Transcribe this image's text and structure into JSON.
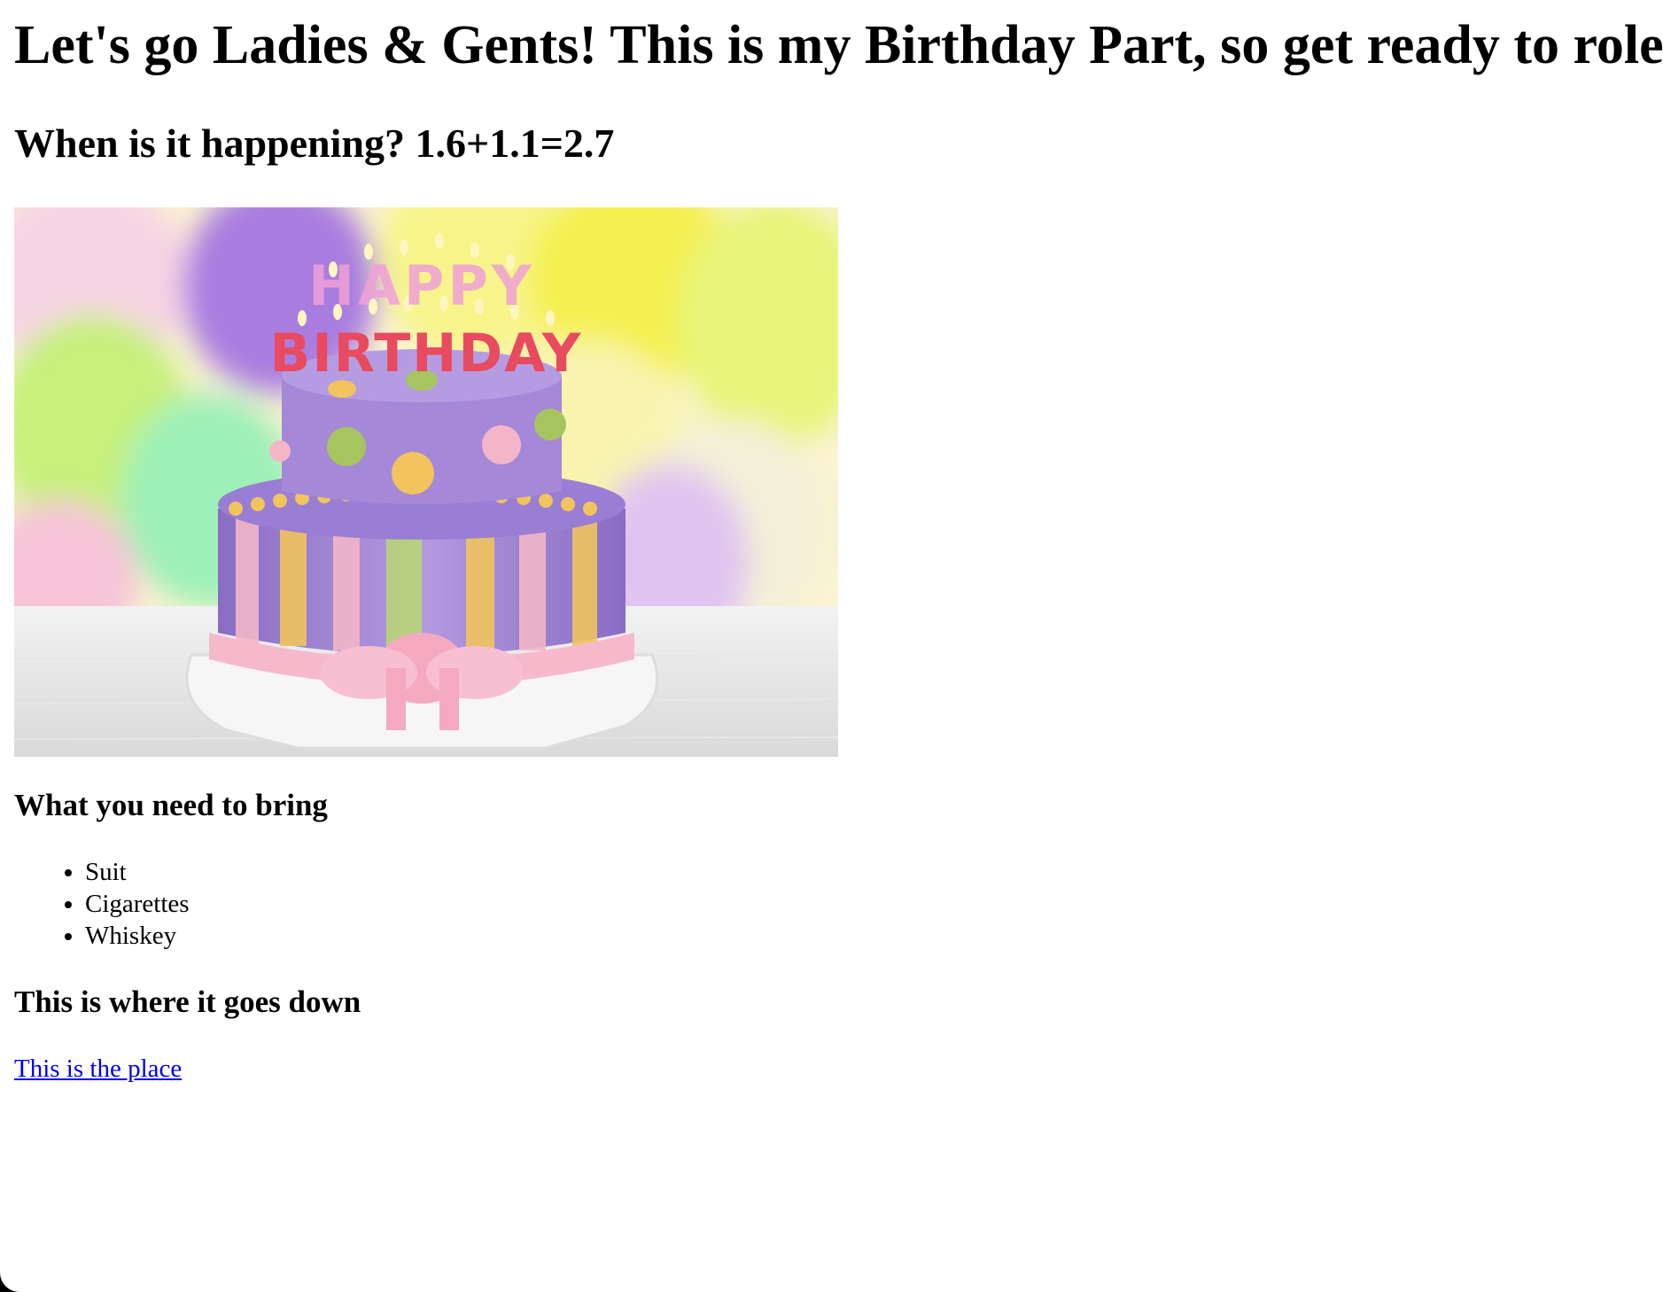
{
  "heading": "Let's go Ladies & Gents! This is my Birthday Part, so get ready to role!",
  "when": "When is it happening? 1.6+1.1=2.7",
  "image": {
    "candle_top_text": "HAPPY",
    "candle_bottom_text": "BIRTHDAY"
  },
  "bring": {
    "heading": "What you need to bring",
    "items": [
      "Suit",
      "Cigarettes",
      "Whiskey"
    ]
  },
  "location": {
    "heading": "This is where it goes down",
    "link_text": "This is the place"
  }
}
